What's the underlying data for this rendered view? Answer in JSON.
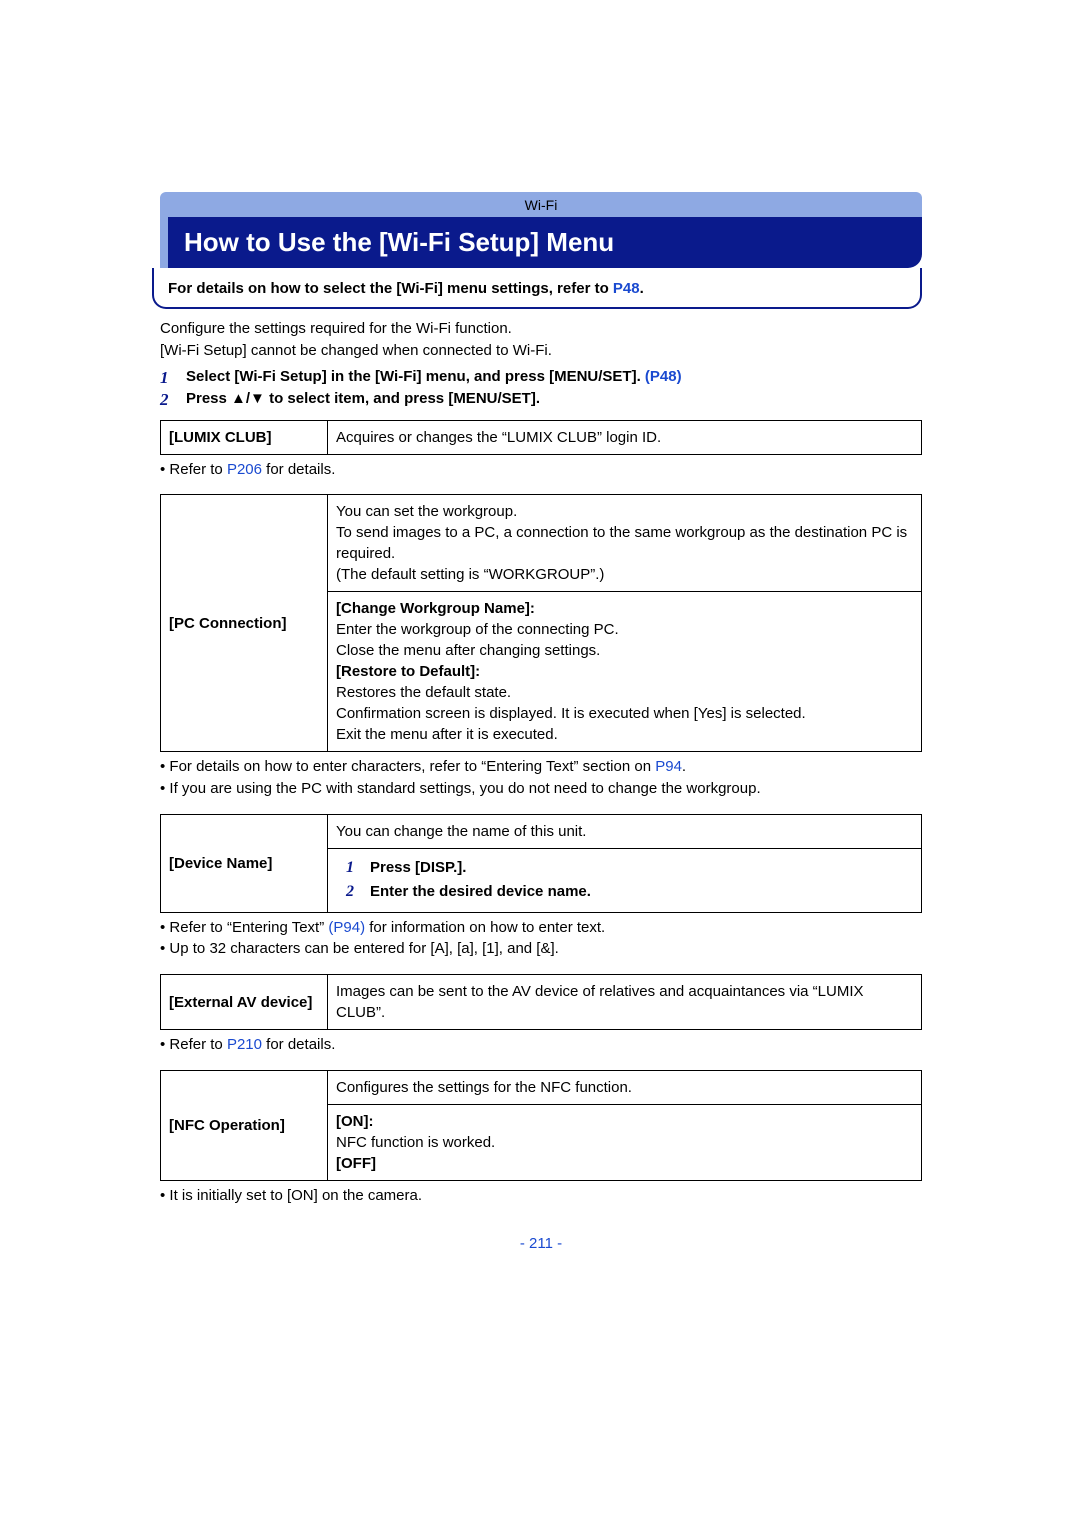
{
  "section": "Wi-Fi",
  "title": "How to Use the [Wi-Fi Setup] Menu",
  "intro": {
    "text_pre": "For details on how to select the [Wi-Fi] menu settings, refer to ",
    "link": "P48",
    "text_post": "."
  },
  "para1": "Configure the settings required for the Wi-Fi function.",
  "para2": "[Wi-Fi Setup] cannot be changed when connected to Wi-Fi.",
  "steps": [
    {
      "num": "1",
      "text_pre": "Select [Wi-Fi Setup] in the [Wi-Fi] menu, and press [MENU/SET]. ",
      "link": "(P48)"
    },
    {
      "num": "2",
      "text_pre": "Press ",
      "arrows": "▲/▼",
      "text_post": " to select item, and press [MENU/SET]."
    }
  ],
  "lumix_club": {
    "label": "[LUMIX CLUB]",
    "desc": "Acquires or changes the “LUMIX CLUB” login ID."
  },
  "lumix_note_pre": "Refer to ",
  "lumix_note_link": "P206",
  "lumix_note_post": " for details.",
  "pc_connection": {
    "label": "[PC Connection]",
    "row1_l1": "You can set the workgroup.",
    "row1_l2": "To send images to a PC, a connection to the same workgroup as the destination PC is required.",
    "row1_l3": "(The default setting is “WORKGROUP”.)",
    "row2_h1": "[Change Workgroup Name]:",
    "row2_l1": "Enter the workgroup of the connecting PC.",
    "row2_l2": "Close the menu after changing settings.",
    "row2_h2": "[Restore to Default]:",
    "row2_l3": "Restores the default state.",
    "row2_l4": "Confirmation screen is displayed. It is executed when [Yes] is selected.",
    "row2_l5": "Exit the menu after it is executed."
  },
  "pc_notes": {
    "n1_pre": "For details on how to enter characters, refer to “Entering Text” section on ",
    "n1_link": "P94",
    "n1_post": ".",
    "n2": "If you are using the PC with standard settings, you do not need to change the workgroup."
  },
  "device_name": {
    "label": "[Device Name]",
    "row1": "You can change the name of this unit.",
    "s1": {
      "num": "1",
      "text": "Press [DISP.]."
    },
    "s2": {
      "num": "2",
      "text": "Enter the desired device name."
    }
  },
  "device_notes": {
    "n1_pre": "Refer to “Entering Text” ",
    "n1_link": "(P94)",
    "n1_post": " for information on how to enter text.",
    "n2": "Up to 32 characters can be entered for [A], [a], [1], and [&]."
  },
  "external_av": {
    "label": "[External AV device]",
    "desc": "Images can be sent to the AV device of relatives and acquaintances via “LUMIX CLUB”."
  },
  "external_note_pre": "Refer to ",
  "external_note_link": "P210",
  "external_note_post": " for details.",
  "nfc": {
    "label": "[NFC Operation]",
    "row1": "Configures the settings for the NFC function.",
    "row2_h1": "[ON]:",
    "row2_l1": "NFC function is worked.",
    "row2_h2": "[OFF]"
  },
  "nfc_note": "It is initially set to [ON] on the camera.",
  "page_number": "- 211 -"
}
